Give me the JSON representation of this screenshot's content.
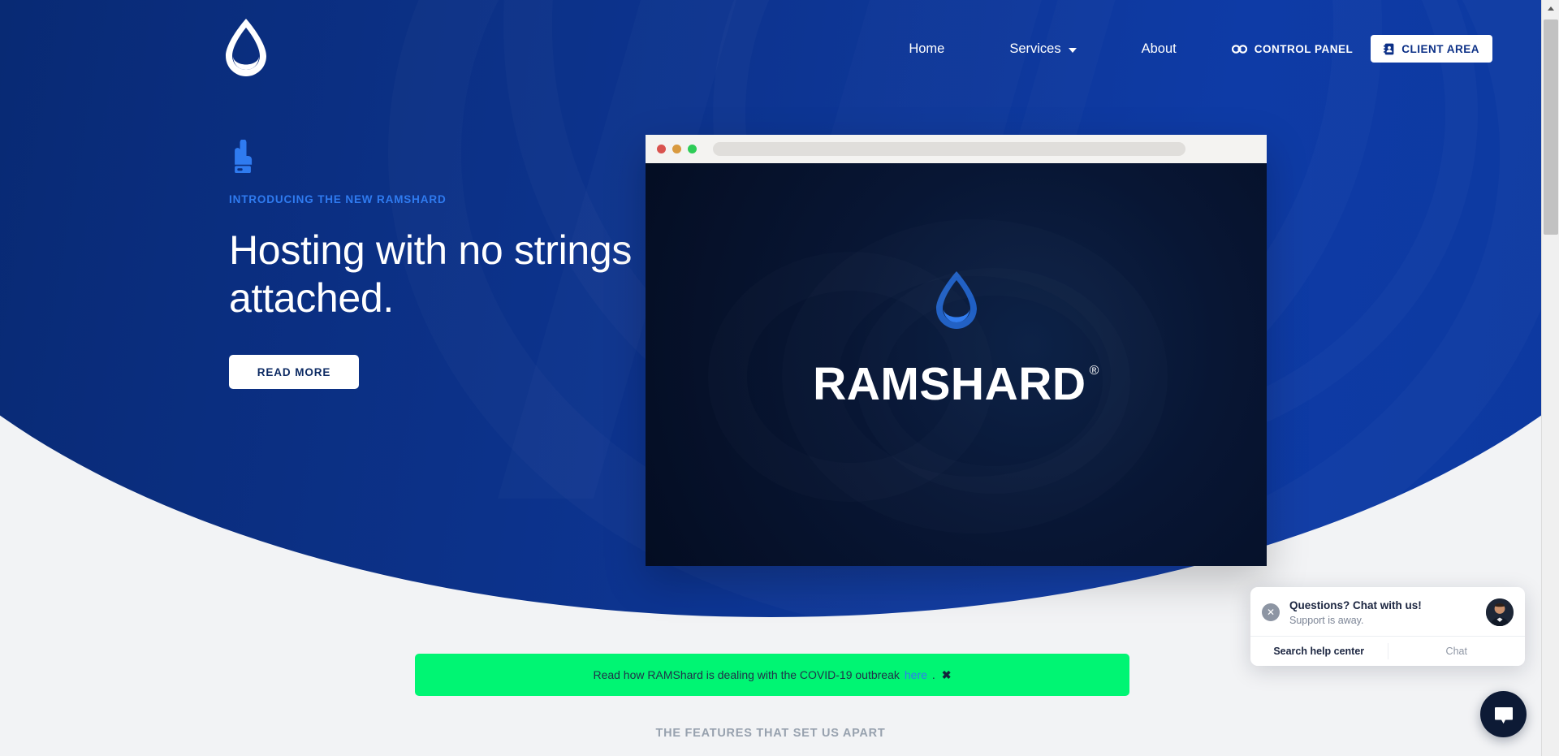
{
  "brand": {
    "name": "RAMSHARD",
    "registered_mark": "®",
    "logo_icon": "droplet-logo-icon",
    "accent_blue": "#2f7bf0",
    "hero_blue_dark": "#0a2d7d",
    "hero_blue_light": "#0e3ba6",
    "banner_green": "#00f573"
  },
  "nav": {
    "logo_name": "ramshard-logo",
    "links": [
      {
        "label": "Home",
        "has_caret": false
      },
      {
        "label": "Services",
        "has_caret": true
      },
      {
        "label": "About",
        "has_caret": false
      }
    ],
    "control_panel": {
      "label": "CONTROL PANEL",
      "icon": "link-chain-icon"
    },
    "client_area": {
      "label": "CLIENT AREA",
      "icon": "address-book-icon"
    }
  },
  "hero": {
    "pointer_icon": "hand-pointing-up-icon",
    "eyebrow": "INTRODUCING THE NEW RAMSHARD",
    "headline": "Hosting with no strings attached.",
    "cta_label": "READ MORE"
  },
  "browser_mockup": {
    "traffic_lights": [
      {
        "name": "close-dot",
        "color": "#d9534f"
      },
      {
        "name": "minimize-dot",
        "color": "#d99a3f"
      },
      {
        "name": "maximize-dot",
        "color": "#2ecc57"
      }
    ],
    "url_value": "",
    "url_placeholder": "",
    "screen_logo": "droplet-logo-icon",
    "screen_wordmark": "RAMSHARD",
    "screen_registered": "®"
  },
  "covid_banner": {
    "text_before": "Read how RAMShard is dealing with the COVID-19 outbreak",
    "link_label": "here",
    "text_after": ".",
    "close_label": "✖"
  },
  "features": {
    "section_eyebrow": "THE FEATURES THAT SET US APART"
  },
  "chat_widget": {
    "close_label": "✕",
    "title": "Questions? Chat with us!",
    "subtitle": "Support is away.",
    "avatar_name": "support-agent-avatar",
    "search_label": "Search help center",
    "chat_label": "Chat",
    "launcher_icon": "chat-bubble-icon"
  },
  "scrollbar": {
    "up_arrow": "scroll-up-arrow"
  }
}
